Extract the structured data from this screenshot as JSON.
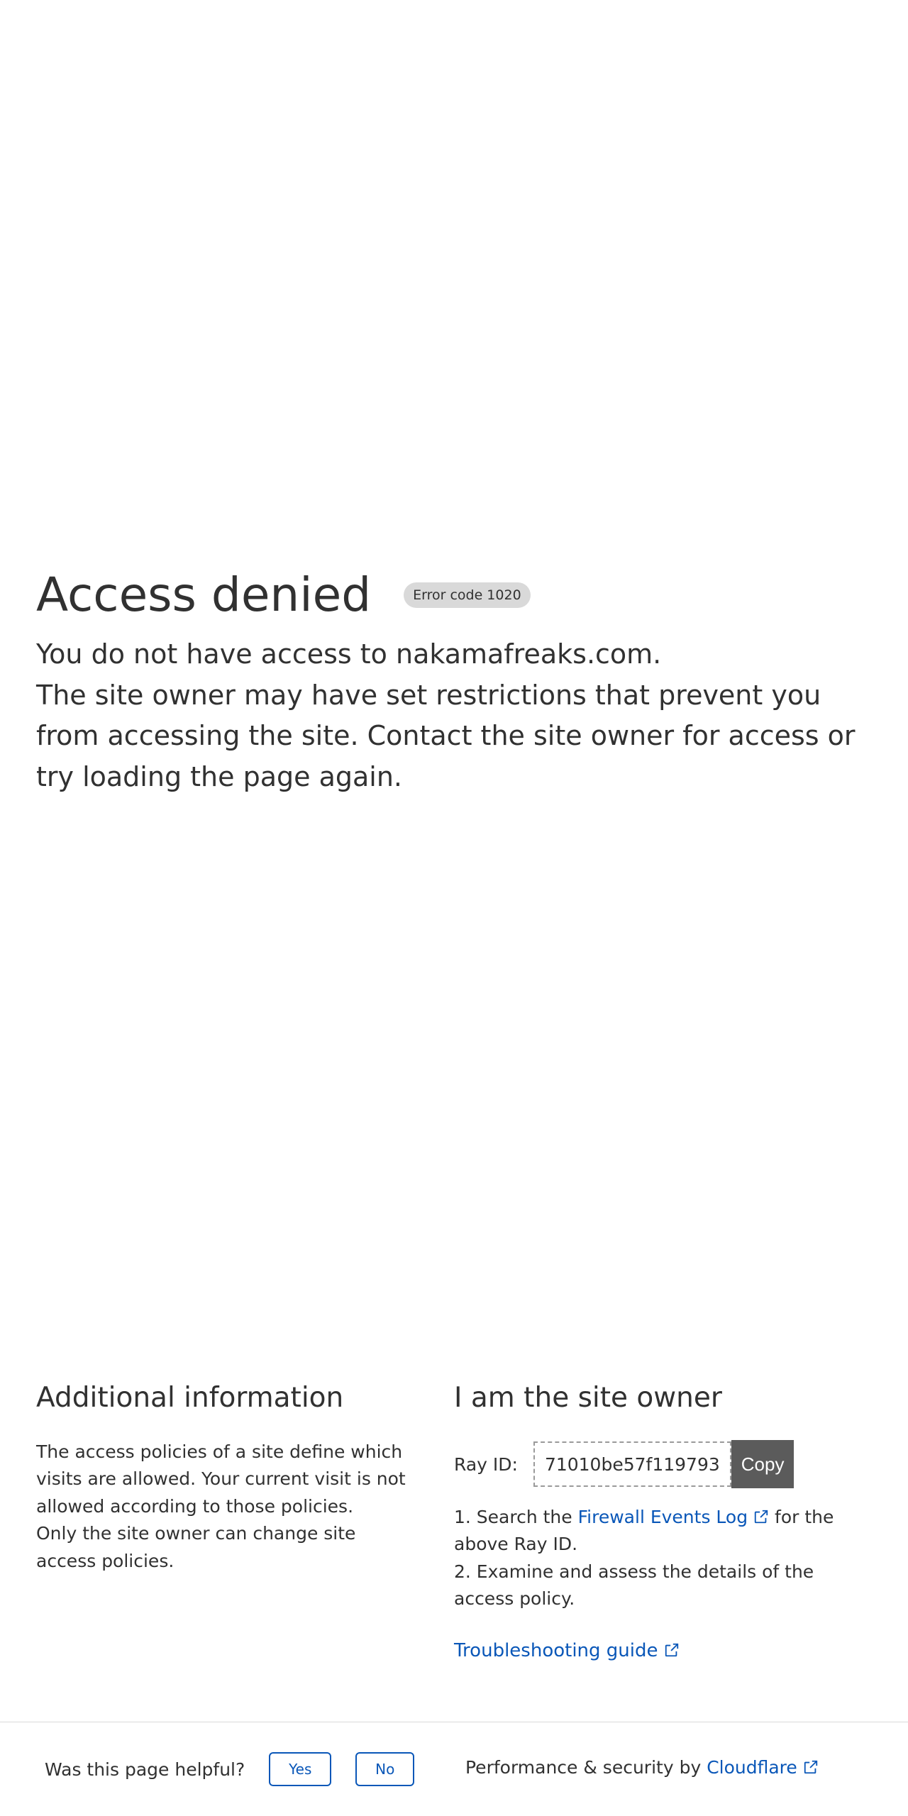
{
  "main": {
    "title": "Access denied",
    "error_badge": "Error code 1020",
    "line1": "You do not have access to nakamafreaks.com.",
    "line2": "The site owner may have set restrictions that prevent you from accessing the site. Contact the site owner for access or try loading the page again."
  },
  "additional": {
    "title": "Additional information",
    "para1": "The access policies of a site define which visits are allowed. Your current visit is not allowed according to those policies.",
    "para2": "Only the site owner can change site access policies."
  },
  "owner": {
    "title": "I am the site owner",
    "ray_label": "Ray ID:",
    "ray_id": "71010be57f119793",
    "copy_label": "Copy",
    "step1_prefix": "1. Search the ",
    "step1_link": "Firewall Events Log",
    "step1_suffix": " for the above Ray ID.",
    "step2": "2. Examine and assess the details of the access policy.",
    "troubleshoot_link": "Troubleshooting guide"
  },
  "footer": {
    "helpful_question": "Was this page helpful?",
    "yes_label": "Yes",
    "no_label": "No",
    "perf_prefix": "Performance & security by ",
    "cloudflare_link": "Cloudflare"
  },
  "colors": {
    "text": "#313131",
    "link": "#0a57b8",
    "badge_bg": "#d9d9d9",
    "copy_bg": "#5b5b5b"
  },
  "icons": {
    "external_link": "external-link-icon"
  }
}
